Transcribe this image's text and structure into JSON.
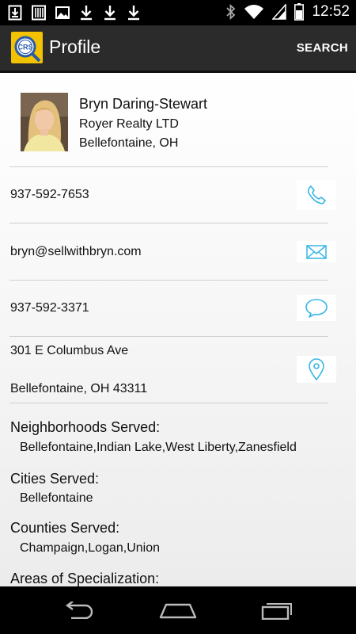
{
  "status_bar": {
    "time": "12:52",
    "icons": [
      "download-box-icon",
      "barcode-icon",
      "image-icon",
      "download-icon",
      "download-icon",
      "download-icon",
      "bluetooth-icon",
      "wifi-icon",
      "signal-icon",
      "battery-icon"
    ]
  },
  "action_bar": {
    "title": "Profile",
    "search_label": "SEARCH",
    "logo_text": "CRS"
  },
  "profile": {
    "name": "Bryn Daring-Stewart",
    "company": "Royer Realty LTD",
    "city": "Bellefontaine, OH"
  },
  "contacts": {
    "phone": "937-592-7653",
    "email": "bryn@sellwithbryn.com",
    "sms": "937-592-3371",
    "address_line1": "301 E Columbus Ave",
    "address_line2": "Bellefontaine, OH 43311"
  },
  "sections": [
    {
      "title": "Neighborhoods Served:",
      "value": "Bellefontaine,Indian Lake,West Liberty,Zanesfield"
    },
    {
      "title": "Cities Served:",
      "value": "Bellefontaine"
    },
    {
      "title": "Counties Served:",
      "value": "Champaign,Logan,Union"
    },
    {
      "title": "Areas of Specialization:",
      "value": ""
    }
  ],
  "colors": {
    "accent": "#33b5e5",
    "logo_yellow": "#f3c200",
    "action_bar": "#2b2b2b"
  }
}
